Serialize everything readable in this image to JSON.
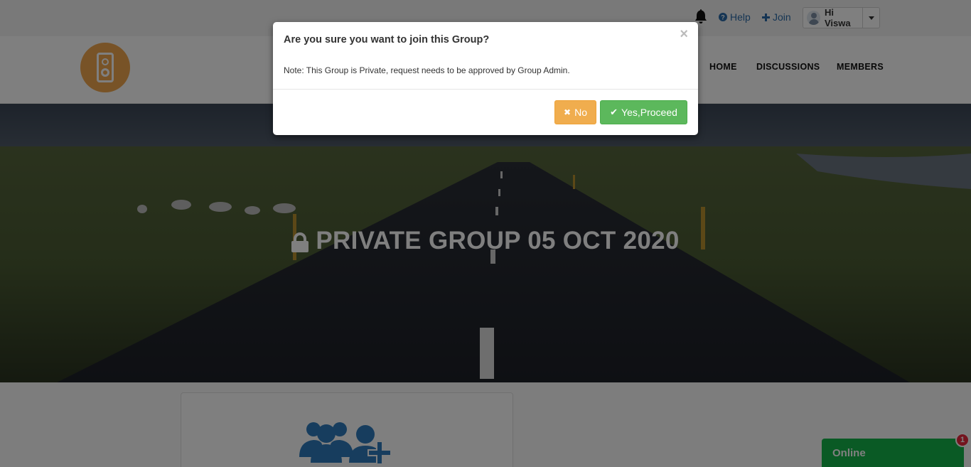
{
  "topbar": {
    "help_label": "Help",
    "help_icon": "question-circle-icon",
    "join_label": "Join",
    "join_icon": "plus-icon",
    "user_greeting": "Hi Viswa"
  },
  "nav": {
    "items": [
      {
        "label": "HOME"
      },
      {
        "label": "DISCUSSIONS"
      },
      {
        "label": "MEMBERS"
      }
    ]
  },
  "hero": {
    "title": "PRIVATE GROUP 05 OCT 2020",
    "lock_icon": "lock-icon"
  },
  "modal": {
    "title": "Are you sure you want to join this Group?",
    "close_glyph": "×",
    "note": "Note: This Group is Private, request needs to be approved by Group Admin.",
    "no_label": "No",
    "yes_label": "Yes,Proceed"
  },
  "chat": {
    "status_label": "Online",
    "badge_count": "1"
  },
  "colors": {
    "link": "#2a6aa8",
    "logo": "#f0a74f",
    "no_button": "#f0ad4e",
    "yes_button": "#5cb85c",
    "online_widget": "#15b54a",
    "badge": "#e8283d",
    "group_icon": "#2e7bbd"
  }
}
